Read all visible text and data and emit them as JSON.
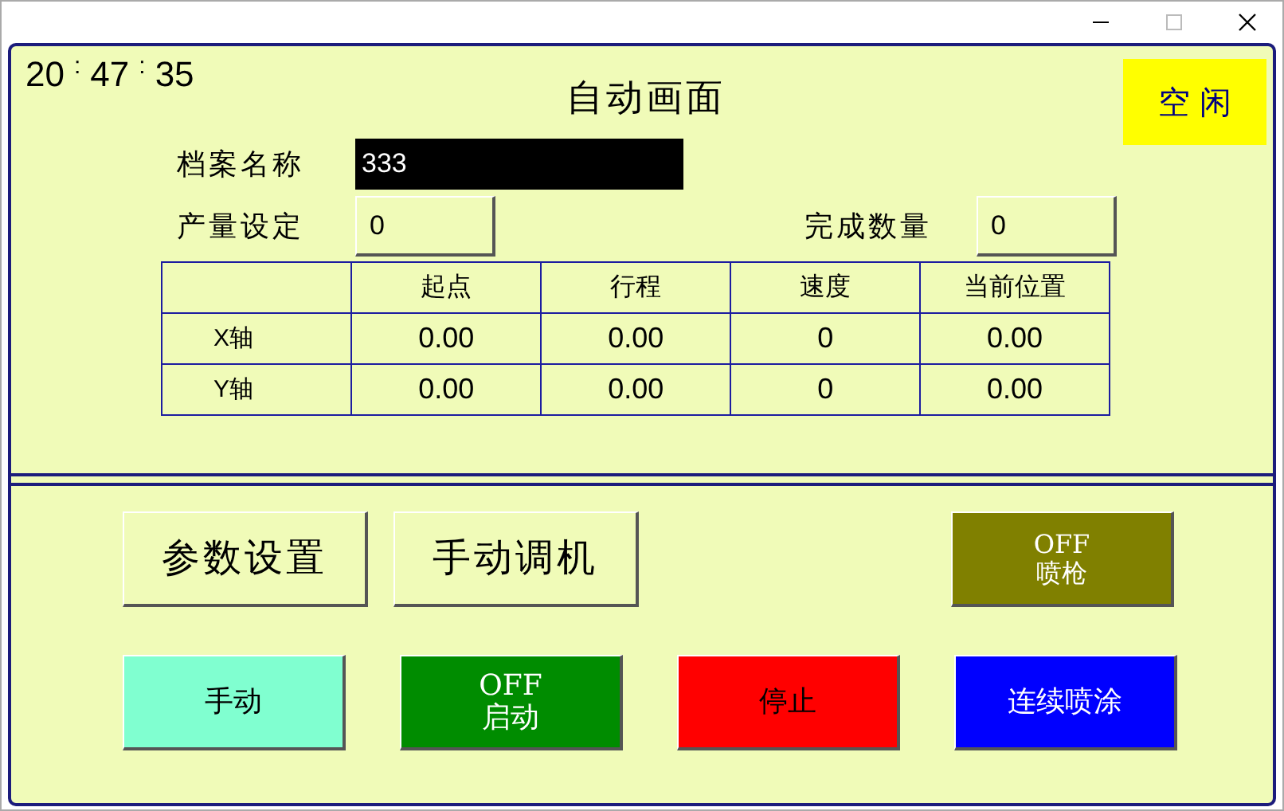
{
  "clock": [
    "20",
    ":",
    "47",
    ":",
    "35"
  ],
  "title": "自动画面",
  "status": "空 闲",
  "file_name": {
    "label": "档案名称",
    "value": "333"
  },
  "production_setting": {
    "label": "产量设定",
    "value": "0"
  },
  "completed_count": {
    "label": "完成数量",
    "value": "0"
  },
  "table": {
    "columns": [
      "",
      "起点",
      "行程",
      "速度",
      "当前位置"
    ],
    "rows": [
      [
        "X轴",
        "0.00",
        "0.00",
        "0",
        "0.00"
      ],
      [
        "Y轴",
        "0.00",
        "0.00",
        "0",
        "0.00"
      ]
    ]
  },
  "top_buttons": [
    {
      "kind": "plain",
      "label": "参数设置"
    },
    {
      "kind": "plain",
      "label": "手动调机"
    },
    {
      "kind": "toggle",
      "state_text": "OFF",
      "label": "喷枪",
      "color": "#808000",
      "dark_text": false
    }
  ],
  "bottom_buttons": [
    {
      "kind": "color",
      "label": "手动",
      "color": "#80ffd0",
      "dark_text": true
    },
    {
      "kind": "toggle",
      "state_text": "OFF",
      "label": "启动",
      "color": "#008c00",
      "dark_text": false
    },
    {
      "kind": "color",
      "label": "停止",
      "color": "#ff0000",
      "dark_text": true
    },
    {
      "kind": "color",
      "label": "连续喷涂",
      "color": "#0000ff",
      "dark_text": false
    }
  ]
}
